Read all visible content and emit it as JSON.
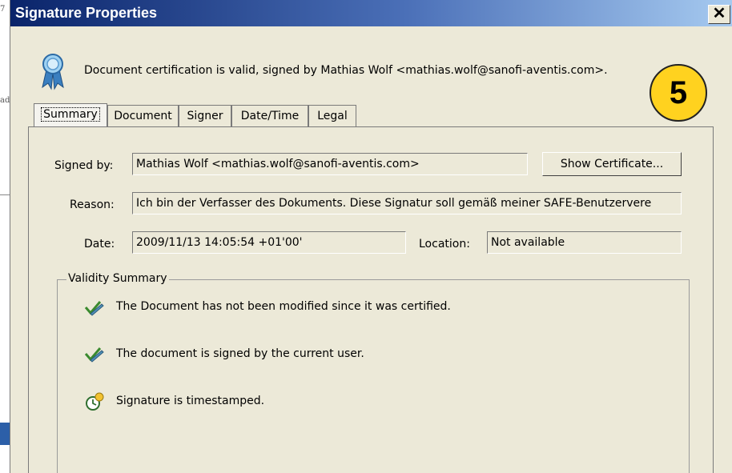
{
  "background": {
    "frag_top": "7",
    "frag_mid": "ad"
  },
  "window": {
    "title": "Signature Properties",
    "close": "✕"
  },
  "header": {
    "message": "Document certification is valid, signed by Mathias Wolf <mathias.wolf@sanofi-aventis.com>.",
    "icon": "ribbon-seal-icon"
  },
  "badge": "5",
  "tabs": [
    "Summary",
    "Document",
    "Signer",
    "Date/Time",
    "Legal"
  ],
  "summary": {
    "signed_by_label": "Signed by:",
    "signed_by_value": "Mathias Wolf <mathias.wolf@sanofi-aventis.com>",
    "show_certificate": "Show Certificate...",
    "reason_label": "Reason:",
    "reason_value": "Ich bin der Verfasser des Dokuments. Diese Signatur soll gemäß meiner SAFE-Benutzervere",
    "date_label": "Date:",
    "date_value": "2009/11/13 14:05:54 +01'00'",
    "location_label": "Location:",
    "location_value": "Not available"
  },
  "validity": {
    "title": "Validity Summary",
    "items": [
      {
        "icon": "pen-check-icon",
        "text": "The Document has not been modified since it was certified."
      },
      {
        "icon": "pen-check-icon",
        "text": "The document is signed by the current user."
      },
      {
        "icon": "clock-timestamp-icon",
        "text": "Signature is timestamped."
      }
    ]
  },
  "colors": {
    "title_start": "#0a246a",
    "title_end": "#a6caf0",
    "dialog_bg": "#ece9d8",
    "badge": "#ffd21f"
  }
}
